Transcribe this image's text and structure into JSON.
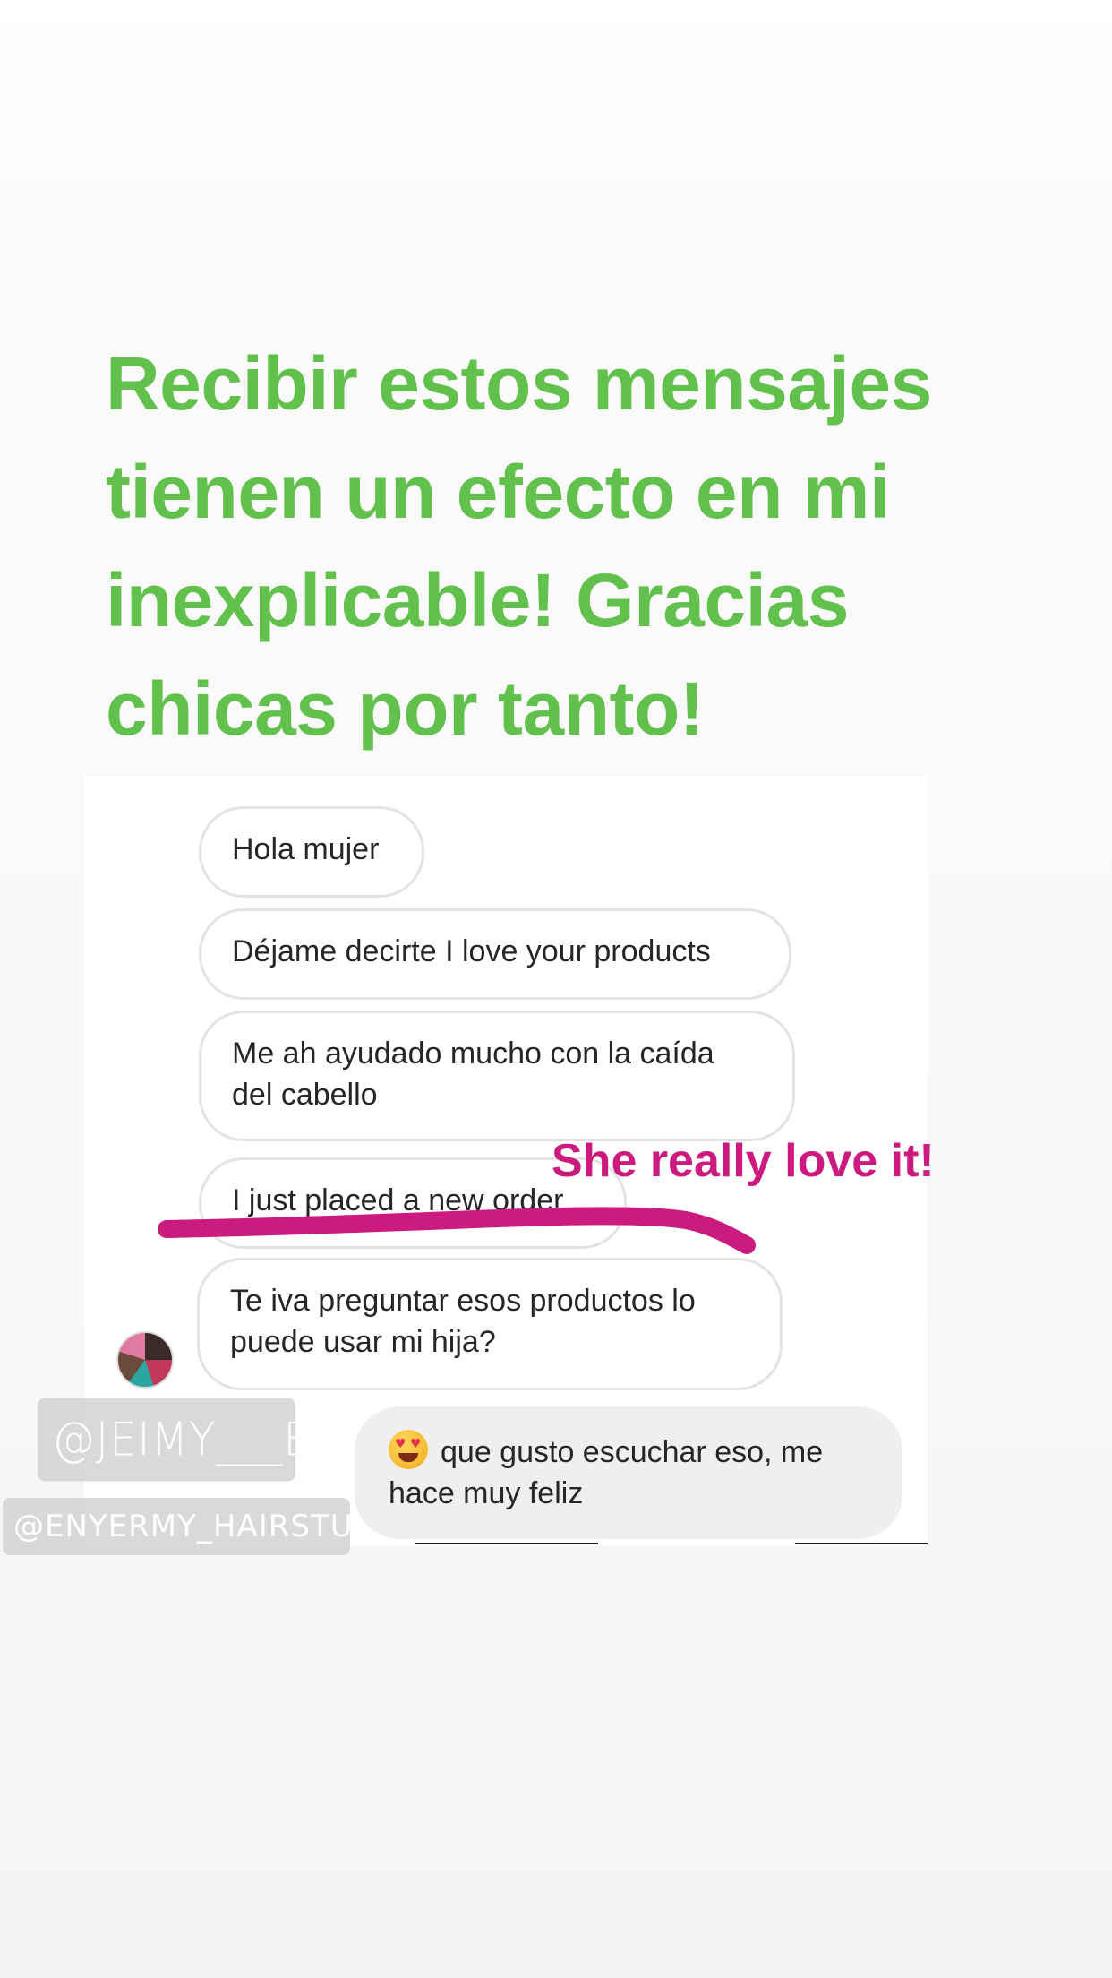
{
  "headline": "Recibir estos mensajes tienen un efecto en mi inexplicable! Gracias chicas por tanto!",
  "messages": [
    {
      "text": "Hola mujer"
    },
    {
      "text": "Déjame decirte I love your products"
    },
    {
      "text": "Me ah ayudado mucho con la caída del cabello"
    },
    {
      "text": "I just placed a new order"
    },
    {
      "text": "Te iva preguntar esos productos lo puede usar mi hija?"
    }
  ],
  "reply": {
    "emoji": "smiling-face-with-heart-eyes",
    "text": "que gusto escuchar eso, me hace muy feliz"
  },
  "annotation": {
    "text": "She really love it!",
    "color": "#cc1b7f"
  },
  "mentions": {
    "primary": "@JEIMY___B",
    "secondary": "@ENYERMY_HAIRSTUDIO"
  },
  "colors": {
    "headline": "#62c14d",
    "accent": "#cc1b7f",
    "reply_bubble": "#efefef"
  }
}
